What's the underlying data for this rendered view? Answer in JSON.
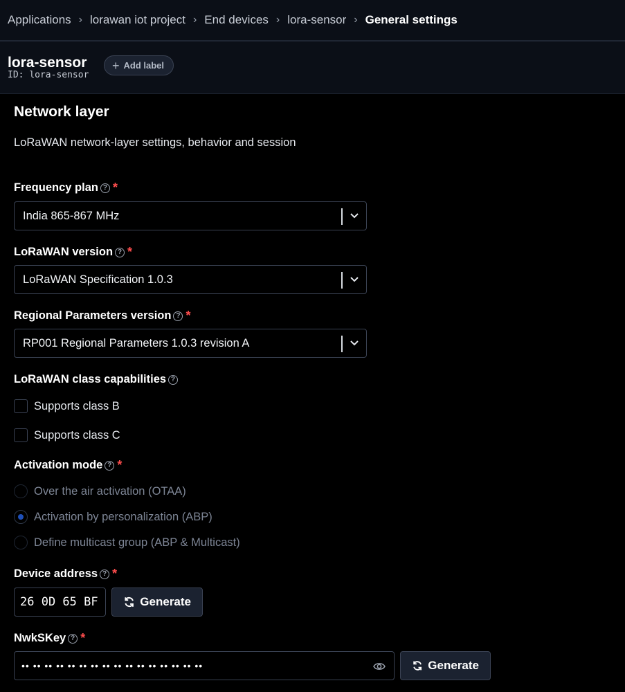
{
  "breadcrumb": [
    "Applications",
    "lorawan iot project",
    "End devices",
    "lora-sensor",
    "General settings"
  ],
  "device": {
    "title": "lora-sensor",
    "id_label": "ID:",
    "id_value": "lora-sensor",
    "add_label": "Add label"
  },
  "section": {
    "title": "Network layer",
    "description": "LoRaWAN network-layer settings, behavior and session"
  },
  "frequency_plan": {
    "label": "Frequency plan",
    "value": "India 865-867 MHz"
  },
  "lorawan_version": {
    "label": "LoRaWAN version",
    "value": "LoRaWAN Specification 1.0.3"
  },
  "regional_params": {
    "label": "Regional Parameters version",
    "value": "RP001 Regional Parameters 1.0.3 revision A"
  },
  "class_caps": {
    "label": "LoRaWAN class capabilities",
    "class_b": "Supports class B",
    "class_c": "Supports class C"
  },
  "activation": {
    "label": "Activation mode",
    "options": [
      "Over the air activation (OTAA)",
      "Activation by personalization (ABP)",
      "Define multicast group (ABP & Multicast)"
    ],
    "selected": "Activation by personalization (ABP)"
  },
  "device_address": {
    "label": "Device address",
    "value": "26 0D 65 BF",
    "generate": "Generate"
  },
  "nwkskey": {
    "label": "NwkSKey",
    "masked_value": "•• •• •• •• •• •• •• •• •• •• •• •• •• •• •• ••",
    "generate": "Generate"
  },
  "help_glyph": "?",
  "required_glyph": "*",
  "colors": {
    "background": "#000000",
    "header_bg": "#0b0f17",
    "required": "#ff4d4d",
    "radio_selected": "#1e4fb8"
  }
}
